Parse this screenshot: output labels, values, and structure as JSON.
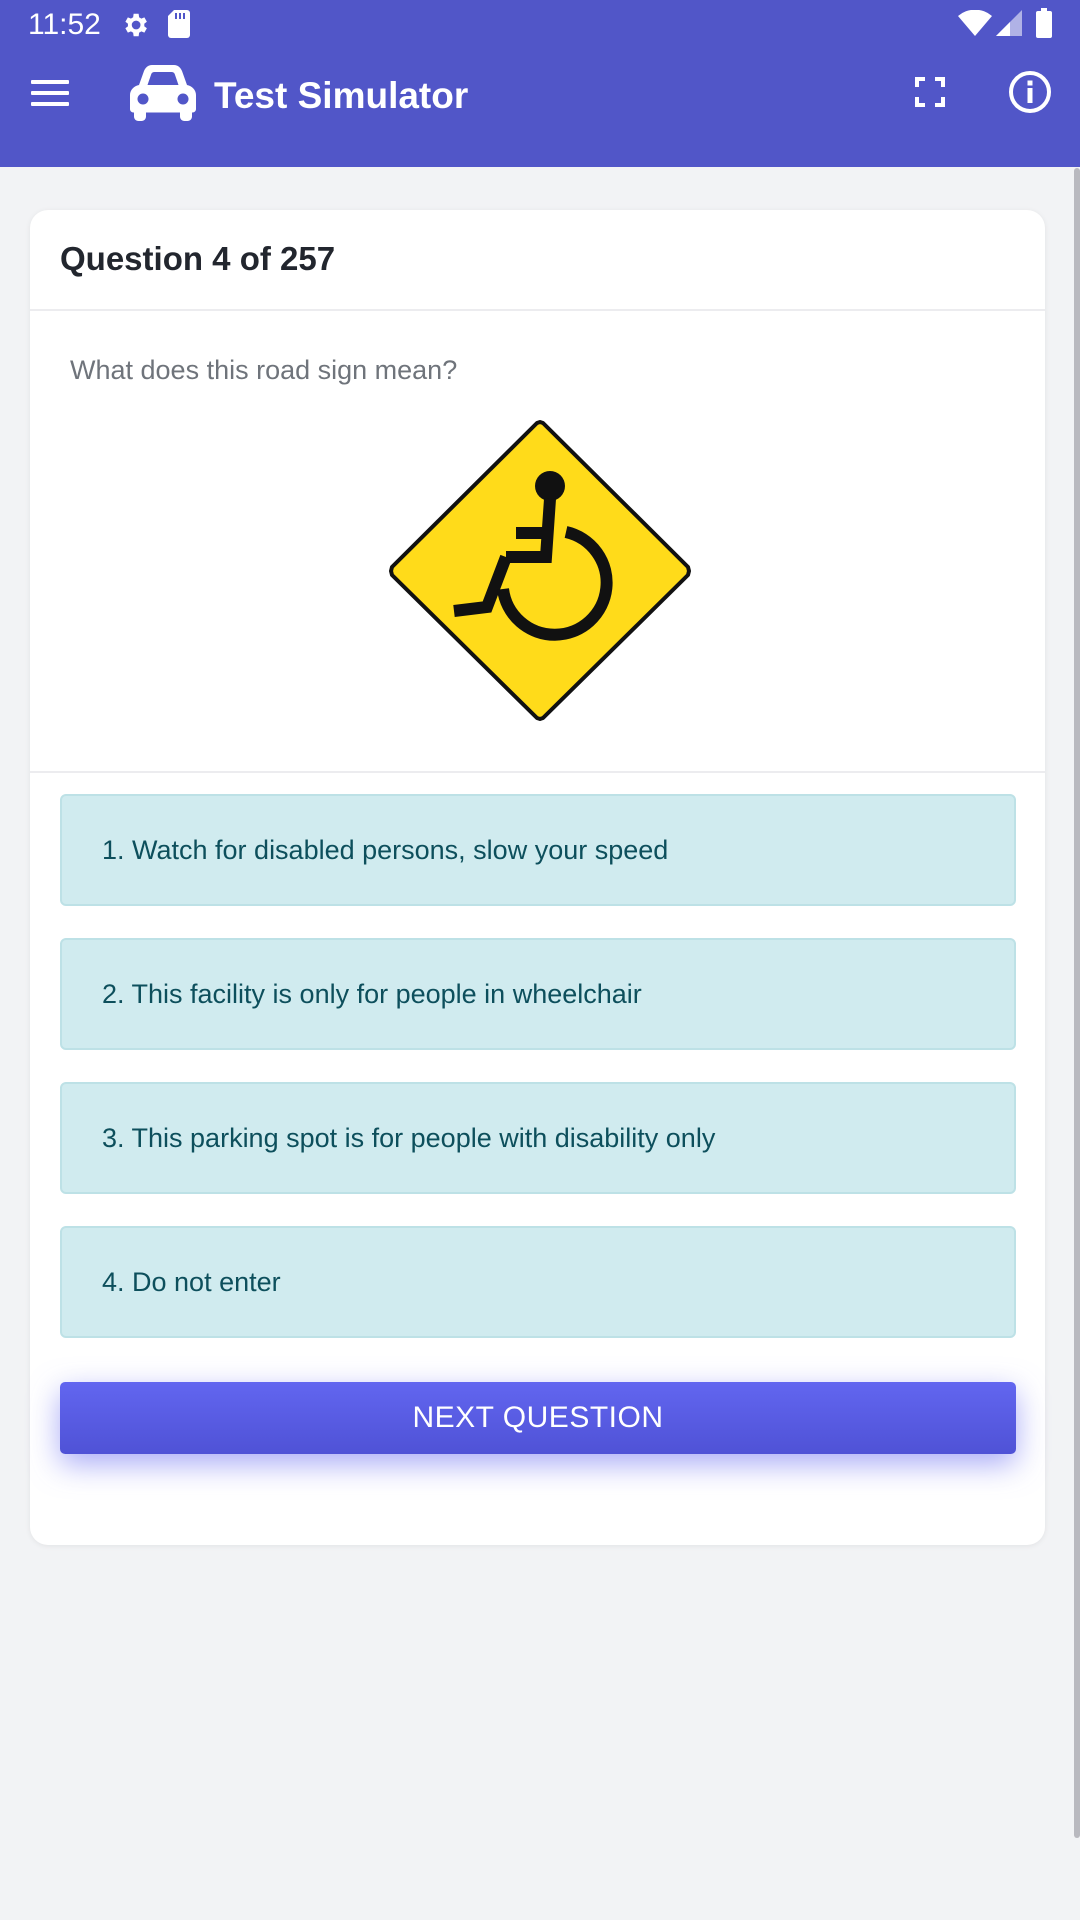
{
  "status_bar": {
    "time": "11:52",
    "icons": [
      "gear-icon",
      "sd-card-icon",
      "wifi-icon",
      "signal-icon",
      "battery-icon"
    ]
  },
  "app_bar": {
    "title": "Test Simulator",
    "icons": [
      "menu-icon",
      "car-icon",
      "fullscreen-icon",
      "info-icon"
    ],
    "color": "#5156c8"
  },
  "quiz": {
    "counter": "Question 4 of 257",
    "question": "What does this road sign mean?",
    "sign_icon": "wheelchair-sign-icon",
    "options": [
      "1. Watch for disabled persons, slow your speed",
      "2. This facility is only for people in wheelchair",
      "3. This parking spot is for people with disability only",
      "4. Do not enter"
    ],
    "next_label": "NEXT QUESTION"
  },
  "colors": {
    "accent": "#5f63ec",
    "option_bg": "#d0ebef",
    "option_text": "#0d4f5c",
    "sign_yellow": "#ffdb1a"
  }
}
